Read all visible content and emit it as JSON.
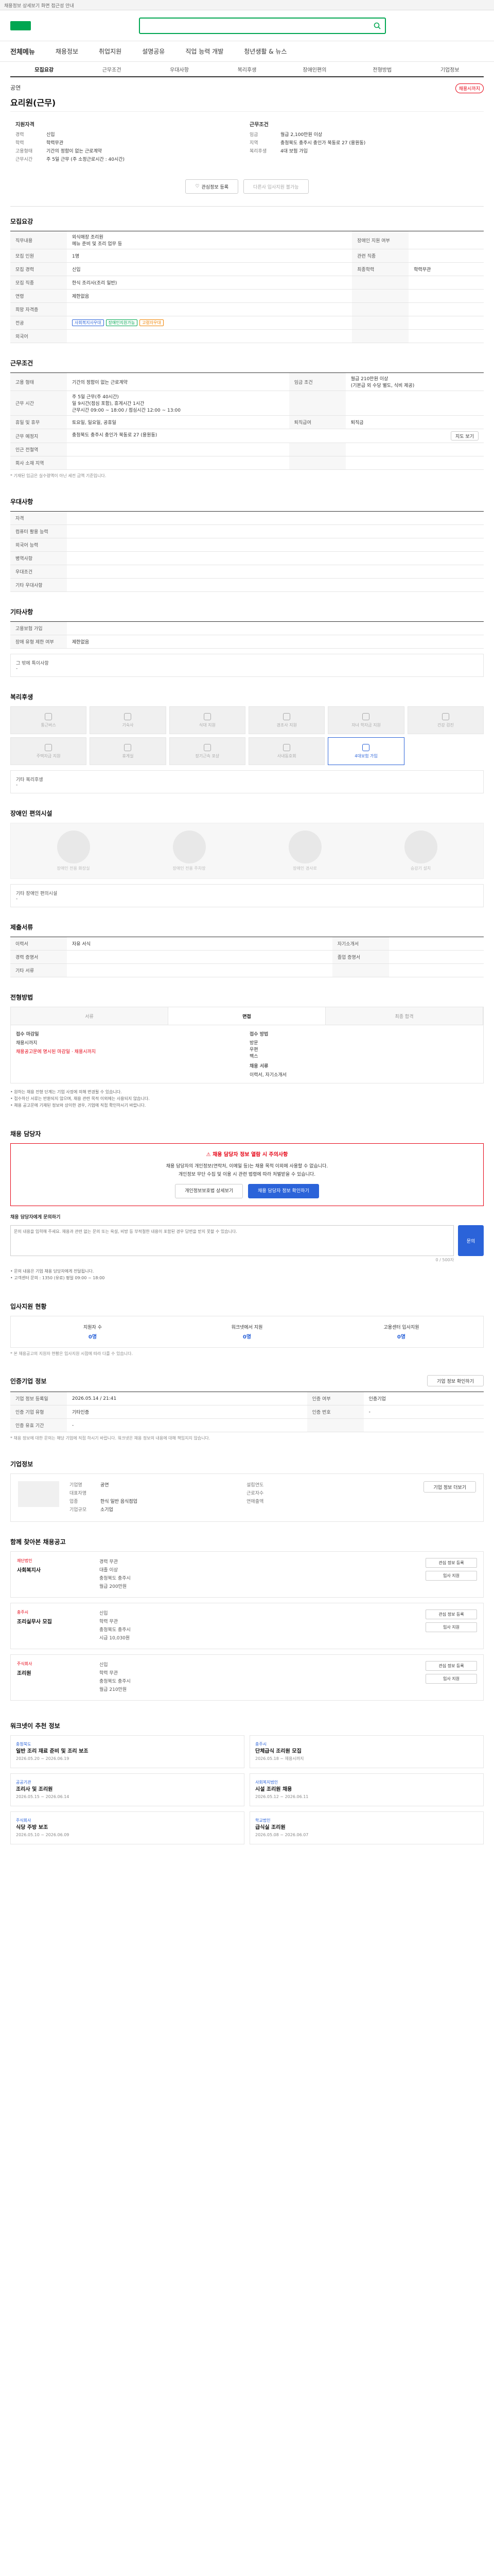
{
  "topbar": {
    "text": "채용정보 상세보기 화면 접근성 안내"
  },
  "header": {
    "search_placeholder": ""
  },
  "gnb": {
    "items": [
      "전체메뉴",
      "채용정보",
      "취업지원",
      "설명공유",
      "직업 능력 개발",
      "청년생활 & 뉴스"
    ]
  },
  "tabs": [
    "모집요강",
    "근무조건",
    "우대사항",
    "복리후생",
    "장애인편의",
    "전형방법",
    "기업정보"
  ],
  "job": {
    "company": "공연",
    "title": "요리원(근무)",
    "status_badge": "채용시까지",
    "left_heading": "지원자격",
    "left_rows": [
      {
        "k": "경력",
        "v": "신입"
      },
      {
        "k": "학력",
        "v": "학력무관"
      },
      {
        "k": "",
        "v": ""
      },
      {
        "k": "고용형태",
        "v": "기간의 정함이 없는 근로계약"
      },
      {
        "k": "근무시간",
        "v": "주 5일 근무 (주 소정근로시간 : 40시간)"
      }
    ],
    "right_heading": "근무조건",
    "right_rows": [
      {
        "k": "임금",
        "v": "월급 2,100만원 이상"
      },
      {
        "k": "지역",
        "v": "충청북도 충주시 충인가 북동로 27 (용원동)"
      },
      {
        "k": "",
        "v": ""
      },
      {
        "k": "복리후생",
        "v": "4대 보험 가입"
      }
    ],
    "action_labels": [
      "관심정보 등록",
      "다른사 입사지원 불가능"
    ]
  },
  "recruit": {
    "title": "모집요강",
    "rows": [
      {
        "k": "직무내용",
        "v": "외식매장 조리원\n메뉴 준비 및 조리 업무 등"
      },
      {
        "k": "모집 인원",
        "v": "1명"
      },
      {
        "k": "모집 경력",
        "v": "신입"
      },
      {
        "k": "모집 직종",
        "v": "한식 조리사(조리 일반)"
      },
      {
        "k": "연령",
        "v": "제한없음"
      },
      {
        "k": "희망 자격증",
        "v": ""
      },
      {
        "k": "전공",
        "v": "학력무관"
      },
      {
        "k": "외국어",
        "v": ""
      }
    ],
    "right_labels": [
      "장애인 지원 여부",
      "관련 직종",
      "최종학력"
    ],
    "right_values": [
      "",
      "",
      "학력무관"
    ],
    "chips": [
      "사회복지사우대",
      "장애인지원가능",
      "고령자우대"
    ]
  },
  "work": {
    "title": "근무조건",
    "rows": [
      {
        "k": "고용 형태",
        "v": "기간의 정함이 없는 근로계약",
        "k2": "임금 조건",
        "v2": "월급 210만원 이상\n(기본급 외 수당 별도, 식비 제공)"
      },
      {
        "k": "근무 시간",
        "v": "주 5일 근무(주 40시간)\n 일 9시간(점심 포함), 휴게시간 1시간\n근무시간 09:00 ~ 18:00 / 점심시간 12:00 ~ 13:00",
        "k2": "",
        "v2": ""
      },
      {
        "k": "휴일 및 휴무",
        "v": "토요일, 일요일, 공휴일",
        "k2": "퇴직급여",
        "v2": "퇴직금"
      },
      {
        "k": "근무 예정지",
        "v": "충청북도 충주시 충인가 북동로 27 (용원동)",
        "k2": "",
        "v2": ""
      },
      {
        "k": "인근 전철역",
        "v": "",
        "k2": "",
        "v2": ""
      },
      {
        "k": "회사 소재 지역",
        "v": "",
        "k2": "",
        "v2": ""
      }
    ],
    "map_button": "지도 보기",
    "note": "* 기재된 임금은 실수령액이 아닌 세전 금액 기준입니다."
  },
  "prefer": {
    "title": "우대사항",
    "rows": [
      {
        "k": "자격",
        "v": ""
      },
      {
        "k": "컴퓨터 활용 능력",
        "v": ""
      },
      {
        "k": "외국어 능력",
        "v": ""
      },
      {
        "k": "병역사항",
        "v": ""
      },
      {
        "k": "우대조건",
        "v": ""
      },
      {
        "k": "기타 우대사항",
        "v": ""
      }
    ]
  },
  "etc": {
    "title": "기타사항",
    "rows": [
      {
        "k": "고용보험 가입",
        "v": ""
      },
      {
        "k": "장애 유형 제한 여부",
        "v": "제한없음"
      }
    ],
    "extra_label": "그 밖에 특이사항",
    "extra_value": "-"
  },
  "welfare": {
    "title": "복리후생",
    "items": [
      {
        "label": "통근버스",
        "on": false
      },
      {
        "label": "기숙사",
        "on": false
      },
      {
        "label": "식대 지원",
        "on": false
      },
      {
        "label": "경조사 지원",
        "on": false
      },
      {
        "label": "자녀 학자금 지원",
        "on": false
      },
      {
        "label": "건강 검진",
        "on": false
      },
      {
        "label": "주택자금 지원",
        "on": false
      },
      {
        "label": "휴게실",
        "on": false
      },
      {
        "label": "장기근속 포상",
        "on": false
      },
      {
        "label": "사내동호회",
        "on": false
      },
      {
        "label": "4대보험 가입",
        "on": true
      }
    ],
    "etc_label": "기타 복리후생",
    "etc_value": "-"
  },
  "disability": {
    "title": "장애인 편의시설",
    "items": [
      "장애인 전용 화장실",
      "장애인 전용 주차장",
      "장애인 경사로",
      "승강기 설치"
    ],
    "etc_label": "기타 장애인 편의시설",
    "etc_value": "-"
  },
  "documents": {
    "title": "제출서류",
    "rows": [
      {
        "k": "이력서",
        "v": "자유 서식",
        "k2": "자기소개서",
        "v2": ""
      },
      {
        "k": "경력 증명서",
        "v": "",
        "k2": "졸업 증명서",
        "v2": ""
      },
      {
        "k": "기타 서류",
        "v": "",
        "k2": "",
        "v2": ""
      }
    ]
  },
  "apply": {
    "title": "전형방법",
    "steps": [
      "서류",
      "면접",
      "최종 합격"
    ],
    "left_label": "접수 마감일",
    "left_value": "채용시까지",
    "left_red": "채용공고문에 명시된 마감일 · 채용시까지",
    "right_label": "접수 방법",
    "right_values": [
      "방문",
      "우편",
      "팩스"
    ],
    "right_extra": "채용 서류",
    "right_extra2": "이력서, 자기소개서",
    "bullets": [
      "• 원하는 채용 전형 단계는 기업 사정에 의해 변경될 수 있습니다.",
      "• 접수하신 서류는 반환되지 않으며, 채용 관련 목적 이외에는 사용되지 않습니다.",
      "• 채용 공고문에 기재된 정보와 상이한 경우, 기업에 직접 확인하시기 바랍니다."
    ]
  },
  "contact": {
    "title": "채용 담당자",
    "warn_title": "채용 담당자 정보 열람 시 주의사항",
    "warn_lines": [
      "채용 담당자의 개인정보(연락처, 이메일 등)는 채용 목적 이외에 사용할 수 없습니다.",
      "개인정보 무단 수집 및 이용 시 관련 법령에 따라 처벌받을 수 있습니다."
    ],
    "btn_left": "개인정보보호법 상세보기",
    "btn_right": "채용 담당자 정보 확인하기",
    "inquiry_label": "채용 담당자에게 문의하기",
    "inquiry_placeholder": "문의 내용을 입력해 주세요. 채용과 관련 없는 문의 또는 욕설, 비방 등 부적절한 내용이 포함된 경우 답변을 받지 못할 수 있습니다.",
    "inquiry_btn": "문의",
    "inquiry_count": "0 / 500자",
    "notes": [
      "• 문의 내용은 기업 채용 담당자에게 전달됩니다.",
      "• 고객센터 문의 : 1350 (유료) 평일 09:00 ~ 18:00"
    ]
  },
  "status": {
    "title": "입사지원 현황",
    "items": [
      {
        "label": "지원자 수",
        "value": "0명"
      },
      {
        "label": "워크넷에서 지원",
        "value": "0명"
      },
      {
        "label": "고용센터 입사지원",
        "value": "0명"
      }
    ],
    "note": "* 본 채용공고의 지원자 현황은 입사지원 시점에 따라 다를 수 있습니다."
  },
  "info": {
    "title": "인증기업 정보",
    "button": "기업 정보 확인하기",
    "rows": [
      {
        "k": "기업 정보 등록일",
        "v": "2026.05.14 / 21:41",
        "k2": "인증 여부",
        "v2": "인증기업"
      },
      {
        "k": "인증 기업 유형",
        "v": "기타인증",
        "k2": "인증 번호",
        "v2": "-"
      },
      {
        "k": "인증 유효 기간",
        "v": "-",
        "k2": "",
        "v2": ""
      }
    ],
    "note": "* 채용 정보에 대한 문의는 해당 기업에 직접 하시기 바랍니다. 워크넷은 채용 정보의 내용에 대해 책임지지 않습니다."
  },
  "company_info": {
    "title": "기업정보",
    "name": "공연",
    "col1": [
      "기업명",
      "대표자명",
      "업종",
      "기업규모"
    ],
    "col1v": [
      "공연",
      "",
      "한식 일반 음식점업",
      "소기업"
    ],
    "col2": [
      "설립연도",
      "근로자수",
      "연매출액"
    ],
    "col2v": [
      "",
      "",
      ""
    ],
    "button": "기업 정보 더보기"
  },
  "similar": {
    "title": "함께 찾아본 채용공고",
    "jobs": [
      {
        "co": "재단법인",
        "title": "사회복지사",
        "meta": [
          "경력 무관",
          "대졸 이상",
          "충청북도 충주시"
        ],
        "pay": "월급 200만원",
        "buttons": [
          "관심 정보 등록",
          "입사 지원"
        ]
      },
      {
        "co": "충주시",
        "title": "조리실무사 모집",
        "meta": [
          "신입",
          "학력 무관",
          "충청북도 충주시"
        ],
        "pay": "시급 10,030원",
        "buttons": [
          "관심 정보 등록",
          "입사 지원"
        ]
      },
      {
        "co": "주식회사",
        "title": "조리원",
        "meta": [
          "신입",
          "학력 무관",
          "충청북도 충주시"
        ],
        "pay": "월급 210만원",
        "buttons": [
          "관심 정보 등록",
          "입사 지원"
        ]
      }
    ]
  },
  "recommend": {
    "title": "워크넷이 추천 정보",
    "items": [
      {
        "co": "충청북도",
        "title": "일반 조리 재료 준비 및 조리 보조",
        "date": "2026.05.20 ~ 2026.06.19"
      },
      {
        "co": "충주시",
        "title": "단체급식 조리원 모집",
        "date": "2026.05.18 ~ 채용시까지"
      },
      {
        "co": "공공기관",
        "title": "조리사 및 조리원",
        "date": "2026.05.15 ~ 2026.06.14"
      },
      {
        "co": "사회복지법인",
        "title": "시설 조리원 채용",
        "date": "2026.05.12 ~ 2026.06.11"
      },
      {
        "co": "주식회사",
        "title": "식당 주방 보조",
        "date": "2026.05.10 ~ 2026.06.09"
      },
      {
        "co": "학교법인",
        "title": "급식실 조리원",
        "date": "2026.05.08 ~ 2026.06.07"
      }
    ]
  }
}
